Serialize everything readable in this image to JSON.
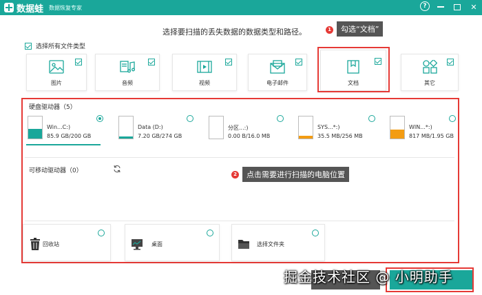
{
  "app": {
    "name": "数据蛙",
    "subtitle": "数据恢复专家"
  },
  "window_controls": {
    "help": "?",
    "minimize": "—",
    "maximize": "□",
    "close": "✕"
  },
  "instruction": "选择要扫描的丢失数据的数据类型和路径。",
  "select_all": {
    "label": "选择所有文件类型",
    "checked": true
  },
  "file_types": [
    {
      "label": "图片",
      "icon": "image-icon",
      "checked": true
    },
    {
      "label": "音频",
      "icon": "music-icon",
      "checked": true
    },
    {
      "label": "视频",
      "icon": "video-icon",
      "checked": true
    },
    {
      "label": "电子邮件",
      "icon": "email-icon",
      "checked": true
    },
    {
      "label": "文档",
      "icon": "document-icon",
      "checked": true
    },
    {
      "label": "其它",
      "icon": "other-icon",
      "checked": true
    }
  ],
  "callouts": [
    {
      "number": "1",
      "text": "勾选“文档”"
    },
    {
      "number": "2",
      "text": "点击需要进行扫描的电脑位置"
    }
  ],
  "hard_drives": {
    "title": "硬盘驱动器（5）",
    "items": [
      {
        "name": "Win...C:)",
        "size": "85.9 GB/200 GB",
        "fill_fraction": 0.43,
        "color": "#1aa79a",
        "selected": true
      },
      {
        "name": "Data (D:)",
        "size": "7.20 GB/274 GB",
        "fill_fraction": 0.03,
        "color": "#1aa79a",
        "selected": false
      },
      {
        "name": "分区...:)",
        "size": "0.00  B/16.0 MB",
        "fill_fraction": 0.0,
        "color": "#f39c12",
        "selected": false
      },
      {
        "name": "SYS...*:)",
        "size": "35.5 MB/256 MB",
        "fill_fraction": 0.14,
        "color": "#f39c12",
        "selected": false
      },
      {
        "name": "WIN...*:)",
        "size": "817 MB/1.95 GB",
        "fill_fraction": 0.41,
        "color": "#f39c12",
        "selected": false
      }
    ]
  },
  "removable": {
    "title": "可移动驱动器（0）",
    "refresh_icon": "refresh-icon"
  },
  "locations": [
    {
      "label": "回收站",
      "icon": "trash-icon"
    },
    {
      "label": "桌面",
      "icon": "desktop-icon"
    },
    {
      "label": "选择文件夹",
      "icon": "folder-icon"
    }
  ],
  "watermark": "掘金技术社区 @ 小明助手",
  "colors": {
    "accent": "#1aa79a",
    "highlight": "#e53935",
    "orange": "#f39c12"
  }
}
